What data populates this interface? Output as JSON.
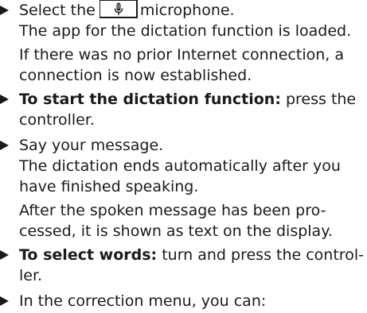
{
  "steps": [
    {
      "lines": [
        {
          "before": "Select the",
          "icon": "microphone-icon",
          "after": "microphone."
        },
        {
          "text": "The app for the dictation function is loaded."
        },
        {
          "text": "If there was no prior Internet connection, a"
        },
        {
          "text": "connection is now established."
        }
      ]
    },
    {
      "lines": [
        {
          "bold": "To start the dictation function:",
          "text": " press the"
        },
        {
          "text": "controller."
        }
      ]
    },
    {
      "lines": [
        {
          "text": "Say your message."
        },
        {
          "text": "The dictation ends automatically after you"
        },
        {
          "text": "have finished speaking."
        },
        {
          "text": "After the spoken message has been pro-"
        },
        {
          "text": "cessed, it is shown as text on the display."
        }
      ]
    },
    {
      "lines": [
        {
          "bold": "To select words:",
          "text": " turn and press the control-"
        },
        {
          "text": "ler."
        }
      ]
    },
    {
      "lines": [
        {
          "text": "In the correction menu, you can:"
        }
      ]
    }
  ]
}
